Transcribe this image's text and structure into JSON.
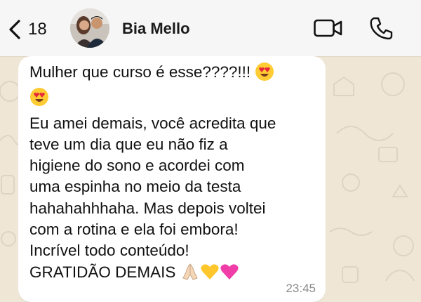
{
  "header": {
    "back_count": "18",
    "contact_name": "Bia Mello",
    "icons": {
      "back": "chevron-left-icon",
      "video": "video-camera-icon",
      "phone": "phone-icon"
    }
  },
  "message": {
    "line1": "Mulher que curso é esse????!!!",
    "body": "Eu amei demais, você acredita que\nteve um dia que eu não fiz a\nhigiene do sono e acordei com\numa espinha no meio da testa\nhahahahhhaha. Mas depois voltei\ncom a rotina e ela foi embora!\nIncrível todo conteúdo!",
    "last_line": "GRATIDÃO DEMAIS",
    "time": "23:45",
    "emojis": [
      "heart-eyes-emoji",
      "heart-eyes-emoji",
      "praying-hands-emoji",
      "yellow-heart-emoji",
      "pink-heart-emoji"
    ]
  },
  "colors": {
    "header_bg": "#f6f6f6",
    "chat_bg": "#efe6d6",
    "bubble_bg": "#ffffff",
    "time": "#8a8a8a"
  }
}
